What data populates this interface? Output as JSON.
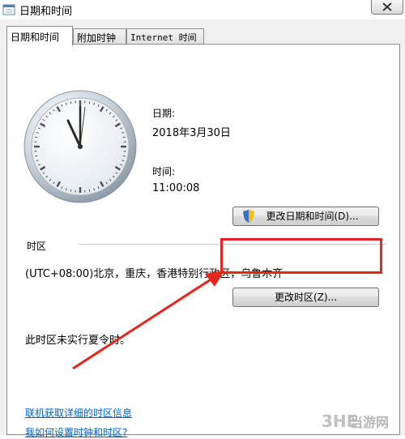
{
  "window": {
    "title": "日期和时间"
  },
  "tabs": [
    {
      "label": "日期和时间"
    },
    {
      "label": "附加时钟"
    },
    {
      "label": "Internet 时间"
    }
  ],
  "date_time": {
    "date_label": "日期:",
    "date_value": "2018年3月30日",
    "time_label": "时间:",
    "time_value": "11:00:08",
    "change_button_label": "更改日期和时间(D)..."
  },
  "timezone": {
    "group_label": "时区",
    "current_zone": "(UTC+08:00)北京，重庆，香港特别行政区，乌鲁木齐",
    "change_button_label": "更改时区(Z)...",
    "dst_note": "此时区未实行夏令时。"
  },
  "links": {
    "online_info": "联机获取详细的时区信息",
    "how_to": "我如何设置时钟和时区?"
  },
  "watermark": {
    "text": "当游网"
  },
  "colors": {
    "highlight": "#e5261d",
    "link": "#0066cc"
  }
}
